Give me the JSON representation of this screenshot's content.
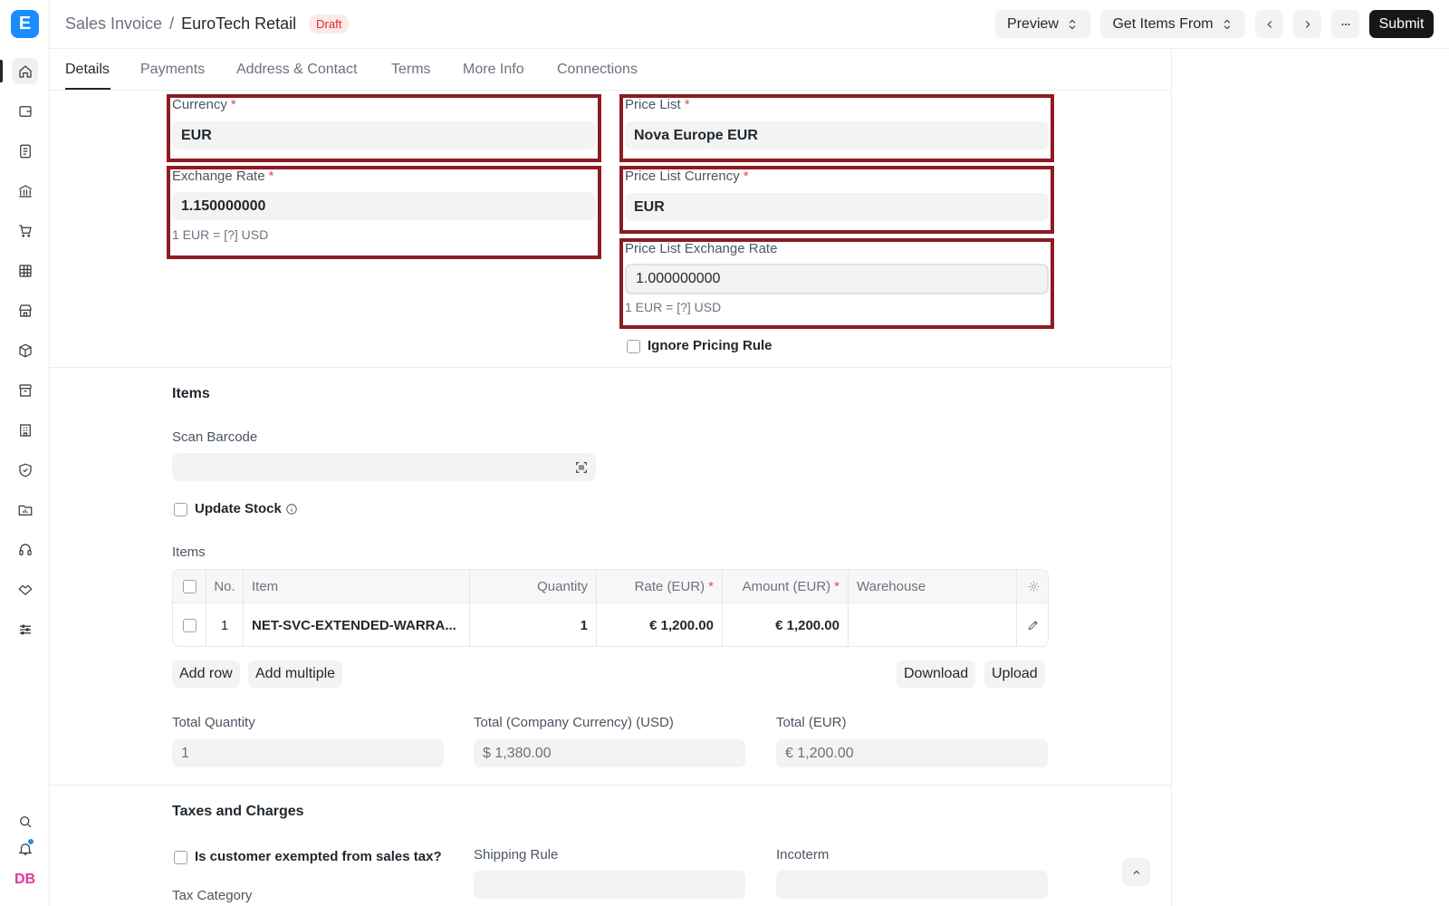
{
  "breadcrumb": {
    "parent": "Sales Invoice",
    "separator": "/",
    "title": "EuroTech Retail",
    "status": "Draft"
  },
  "toolbar": {
    "preview": "Preview",
    "get_items": "Get Items From",
    "submit": "Submit"
  },
  "tabs": [
    "Details",
    "Payments",
    "Address & Contact",
    "Terms",
    "More Info",
    "Connections"
  ],
  "currency": {
    "currency_label": "Currency",
    "currency_value": "EUR",
    "exchange_rate_label": "Exchange Rate",
    "exchange_rate_value": "1.150000000",
    "exchange_rate_hint": "1 EUR = [?] USD",
    "price_list_label": "Price List",
    "price_list_value": "Nova Europe EUR",
    "price_list_currency_label": "Price List Currency",
    "price_list_currency_value": "EUR",
    "price_list_rate_label": "Price List Exchange Rate",
    "price_list_rate_value": "1.000000000",
    "price_list_rate_hint": "1 EUR = [?] USD",
    "ignore_pricing_label": "Ignore Pricing Rule"
  },
  "items_section": {
    "title": "Items",
    "scan_barcode_label": "Scan Barcode",
    "update_stock_label": "Update Stock",
    "table_label": "Items",
    "columns": {
      "no": "No.",
      "item": "Item",
      "quantity": "Quantity",
      "rate": "Rate (EUR)",
      "amount": "Amount (EUR)",
      "warehouse": "Warehouse"
    },
    "rows": [
      {
        "no": "1",
        "item": "NET-SVC-EXTENDED-WARRA...",
        "quantity": "1",
        "rate": "€ 1,200.00",
        "amount": "€ 1,200.00",
        "warehouse": ""
      }
    ],
    "add_row": "Add row",
    "add_multiple": "Add multiple",
    "download": "Download",
    "upload": "Upload"
  },
  "totals": {
    "total_qty_label": "Total Quantity",
    "total_qty_value": "1",
    "total_company_label": "Total (Company Currency) (USD)",
    "total_company_value": "$ 1,380.00",
    "total_label": "Total (EUR)",
    "total_value": "€ 1,200.00"
  },
  "taxes": {
    "title": "Taxes and Charges",
    "exempt_label": "Is customer exempted from sales tax?",
    "shipping_rule_label": "Shipping Rule",
    "incoterm_label": "Incoterm",
    "tax_category_label": "Tax Category"
  },
  "user": {
    "initials": "DB"
  },
  "colors": {
    "accent": "#1a8cff",
    "highlight": "#8e1b22",
    "draft_badge": "#d92c2c",
    "avatar": "#e0379e"
  }
}
